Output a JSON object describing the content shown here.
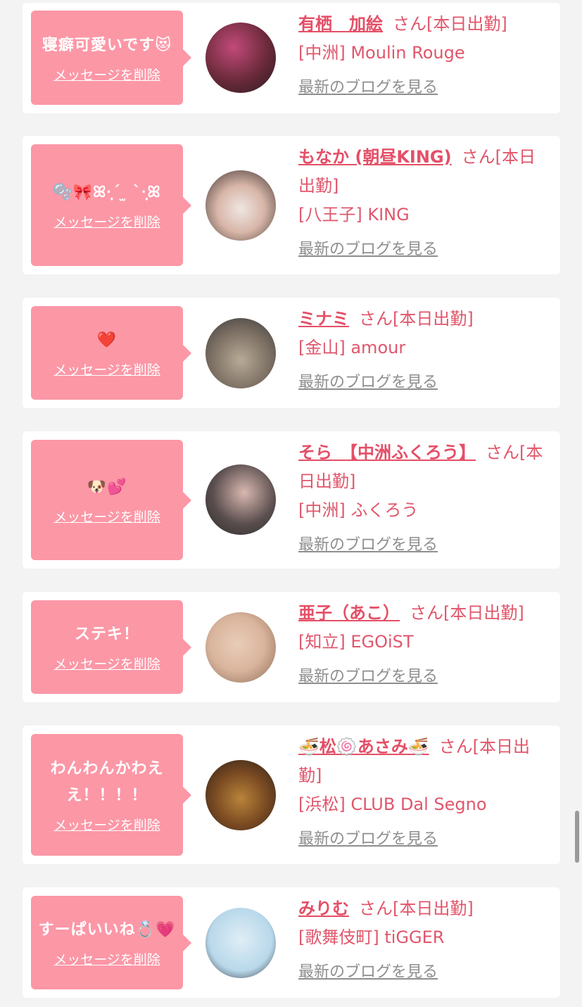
{
  "cards": [
    {
      "message": "寝癖可愛いです😻",
      "delete_label": "メッセージを削除",
      "name": "有栖　加絵",
      "suffix": "さん[本日出勤]",
      "shop": "[中洲] Moulin Rouge",
      "blog_label": "最新のブログを見る",
      "avatar_colors": [
        "#6a2a3a",
        "#c24a7a",
        "#2a1a22"
      ]
    },
    {
      "message": "🫧🎀ꕤ·̩͙ˊ ̫ ˋ·̩͙ꕤ",
      "delete_label": "メッセージを削除",
      "name": "もなか (朝昼KING)",
      "suffix": "さん[本日出勤]",
      "shop": "[八王子] KING",
      "blog_label": "最新のブログを見る",
      "avatar_colors": [
        "#efe6e2",
        "#d8b6a8",
        "#3a2f2c"
      ]
    },
    {
      "message": "❤️",
      "delete_label": "メッセージを削除",
      "name": "ミナミ",
      "suffix": "さん[本日出勤]",
      "shop": "[金山] amour",
      "blog_label": "最新のブログを見る",
      "avatar_colors": [
        "#7a6e62",
        "#b8aa96",
        "#3a3a3a"
      ]
    },
    {
      "message": "🐶💕",
      "delete_label": "メッセージを削除",
      "name": "そら　【中洲ふくろう】",
      "suffix": "さん[本日出勤]",
      "shop": "[中洲] ふくろう",
      "blog_label": "最新のブログを見る",
      "avatar_colors": [
        "#5a4e4e",
        "#d9b8b0",
        "#2c2a2a"
      ]
    },
    {
      "message": "ステキ！",
      "delete_label": "メッセージを削除",
      "name": "亜子（あこ）",
      "suffix": "さん[本日出勤]",
      "shop": "[知立] EGOiST",
      "blog_label": "最新のブログを見る",
      "avatar_colors": [
        "#d9b49c",
        "#e9cdb8",
        "#8a6a58"
      ]
    },
    {
      "message": "わんわんかわええ！！！！",
      "delete_label": "メッセージを削除",
      "name": "🍜松🍥あさみ🍜",
      "suffix": "さん[本日出勤]",
      "shop": "[浜松] CLUB Dal Segno",
      "blog_label": "最新のブログを見る",
      "avatar_colors": [
        "#2a201a",
        "#b9843a",
        "#7a4a22"
      ]
    },
    {
      "message": "すーぱいいね💍💗",
      "delete_label": "メッセージを削除",
      "name": "みりむ",
      "suffix": "さん[本日出勤]",
      "shop": "[歌舞伎町] tiGGER",
      "blog_label": "最新のブログを見る",
      "avatar_colors": [
        "#dfeef6",
        "#b8d8ea",
        "#2c2c3a"
      ]
    }
  ]
}
